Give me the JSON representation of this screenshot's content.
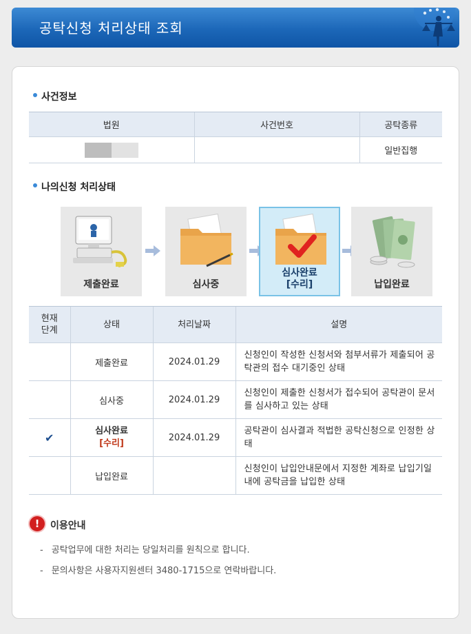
{
  "header": {
    "title": "공탁신청 처리상태 조회"
  },
  "case_info": {
    "title": "사건정보",
    "columns": [
      "법원",
      "사건번호",
      "공탁종류"
    ],
    "row": {
      "court": "",
      "case_number": "",
      "deposit_type": "일반집행"
    }
  },
  "my_status": {
    "title": "나의신청 처리상태",
    "steps": [
      {
        "label": "제출완료",
        "sub": ""
      },
      {
        "label": "심사중",
        "sub": ""
      },
      {
        "label": "심사완료",
        "sub": "[수리]"
      },
      {
        "label": "납입완료",
        "sub": ""
      }
    ],
    "active_step": 2
  },
  "status_table": {
    "headers": {
      "current": "현재\n단계",
      "state": "상태",
      "date": "처리날짜",
      "desc": "설명"
    },
    "rows": [
      {
        "current": "",
        "state": "제출완료",
        "sub": "",
        "date": "2024.01.29",
        "desc": "신청인이 작성한 신청서와 첨부서류가 제출되어 공탁관의 접수 대기중인 상태"
      },
      {
        "current": "",
        "state": "심사중",
        "sub": "",
        "date": "2024.01.29",
        "desc": "신청인이 제출한 신청서가 접수되어 공탁관이 문서를 심사하고 있는 상태"
      },
      {
        "current": "✔",
        "state": "심사완료",
        "sub": "[수리]",
        "date": "2024.01.29",
        "desc": "공탁관이 심사결과 적법한 공탁신청으로 인정한 상태"
      },
      {
        "current": "",
        "state": "납입완료",
        "sub": "",
        "date": "",
        "desc": "신청인이 납입안내문에서 지정한 계좌로 납입기일 내에 공탁금을 납입한 상태"
      }
    ]
  },
  "notice": {
    "icon": "exclamation-icon",
    "title": "이용안내",
    "items": [
      "공탁업무에 대한 처리는 당일처리를 원칙으로 합니다.",
      "문의사항은 사용자지원센터 3480-1715으로 연락바랍니다."
    ]
  },
  "colors": {
    "header_blue": "#1c67b8",
    "accent_red": "#c0391b",
    "check_blue": "#1e4f8f"
  }
}
